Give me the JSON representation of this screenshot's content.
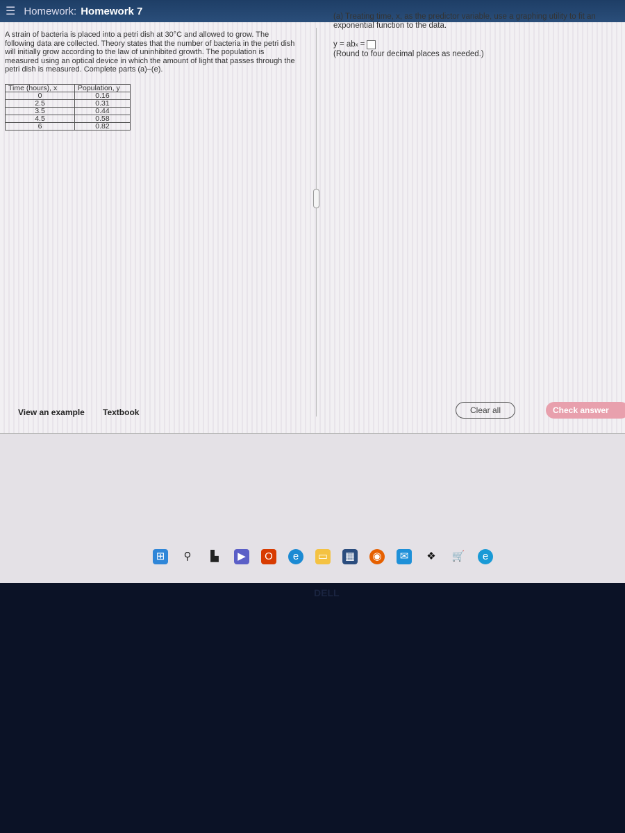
{
  "header": {
    "menu_icon": "hamburger-menu-icon",
    "prefix": "Homework:",
    "title": "Homework 7"
  },
  "problem": {
    "text": "A strain of bacteria is placed into a petri dish at 30°C and allowed to grow. The following data are collected. Theory states that the number of bacteria in the petri dish will initially grow according to the law of uninhibited growth. The population is measured using an optical device in which the amount of light that passes through the petri dish is measured. Complete parts (a)–(e).",
    "table": {
      "headers": [
        "Time (hours), x",
        "Population, y"
      ],
      "rows": [
        [
          "0",
          "0.16"
        ],
        [
          "2.5",
          "0.31"
        ],
        [
          "3.5",
          "0.44"
        ],
        [
          "4.5",
          "0.58"
        ],
        [
          "6",
          "0.82"
        ]
      ]
    }
  },
  "question": {
    "prompt": "(a) Treating time, x, as the predictor variable, use a graphing utility to fit an exponential function to the data.",
    "equation": "y = ab",
    "exponent": "x",
    "equals": "=",
    "answer_value": "",
    "note": "(Round to four decimal places as needed.)"
  },
  "footer": {
    "view_example": "View an example",
    "textbook": "Textbook",
    "clear_all": "Clear all",
    "check_answer": "Check answer"
  },
  "taskbar": {
    "icons": [
      "windows-start-icon",
      "search-icon",
      "task-view-icon",
      "meet-icon",
      "office-icon",
      "edge-icon",
      "file-explorer-icon",
      "store-icon",
      "firefox-icon",
      "mail-icon",
      "dropbox-icon",
      "shopping-icon",
      "edge-beta-icon"
    ]
  },
  "bezel": {
    "brand": "DELL"
  },
  "colors": {
    "header": "#2a4e7a",
    "check_answer": "#e8a0ad"
  }
}
